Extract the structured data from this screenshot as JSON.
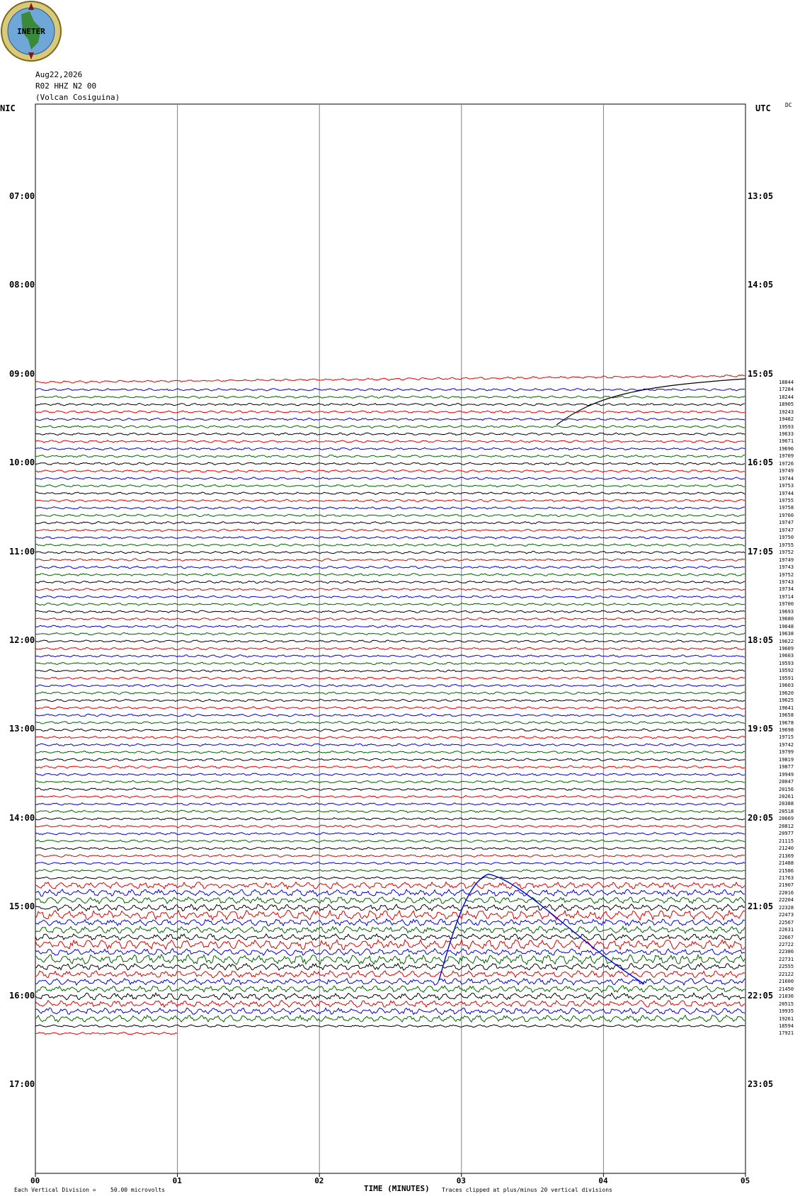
{
  "logo": {
    "text": "INETER"
  },
  "header": {
    "date": "Aug22,2026",
    "station": "R02 HHZ N2 00",
    "location": "(Volcan Cosiguina)"
  },
  "left_axis_title": "NIC",
  "right_axis_title": "UTC",
  "dc_label": "DC",
  "left_hours": [
    "07:00",
    "08:00",
    "09:00",
    "10:00",
    "11:00",
    "12:00",
    "13:00",
    "14:00",
    "15:00",
    "16:00",
    "17:00"
  ],
  "right_hours": [
    "13:05",
    "14:05",
    "15:05",
    "16:05",
    "17:05",
    "18:05",
    "19:05",
    "20:05",
    "21:05",
    "22:05",
    "23:05"
  ],
  "x_ticks": [
    "00",
    "01",
    "02",
    "03",
    "04",
    "05"
  ],
  "x_title": "TIME (MINUTES)",
  "footer": {
    "scale_label": "Each Vertical Division =",
    "scale_value": "50.00 microvolts",
    "clip_note": "Traces clipped at plus/minus 20 vertical divisions"
  },
  "chart_data": {
    "type": "line",
    "title": "R02 HHZ N2 00 (Volcan Cosiguina)",
    "xlabel": "TIME (MINUTES)",
    "xlim": [
      0,
      5
    ],
    "trace_colors": [
      "#e00000",
      "#0000e0",
      "#006400",
      "#000000"
    ],
    "trace_interval_minutes": 5,
    "first_trace_nic": "09:00",
    "last_trace_nic": "16:30",
    "dc_values": [
      18844,
      17284,
      18244,
      18905,
      19243,
      19482,
      19593,
      19633,
      19671,
      19696,
      19709,
      19726,
      19749,
      19744,
      19753,
      19744,
      19755,
      19758,
      19760,
      19747,
      19747,
      19750,
      19755,
      19752,
      19749,
      19743,
      19752,
      19743,
      19734,
      19714,
      19700,
      19693,
      19680,
      19648,
      19638,
      19622,
      19609,
      19603,
      19593,
      19592,
      19591,
      19603,
      19620,
      19625,
      19641,
      19658,
      19678,
      19698,
      19715,
      19742,
      19799,
      19819,
      19877,
      19949,
      20047,
      20156,
      20261,
      20388,
      20518,
      20669,
      20812,
      20977,
      21115,
      21240,
      21369,
      21488,
      21586,
      21763,
      21907,
      22016,
      22204,
      22328,
      22473,
      22567,
      22631,
      22667,
      22722,
      22386,
      22731,
      22555,
      22122,
      21600,
      21450,
      21036,
      20515,
      19935,
      19261,
      18594,
      17921
    ]
  }
}
